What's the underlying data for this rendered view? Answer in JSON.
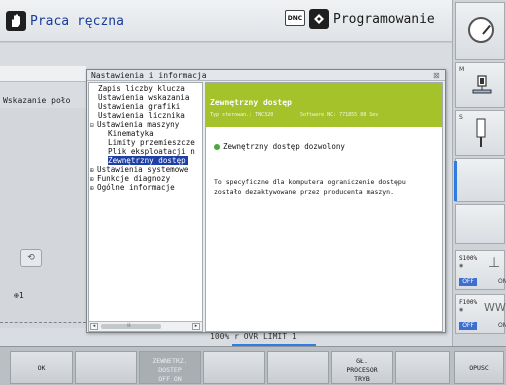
{
  "header": {
    "left_mode": "Praca ręczna",
    "dnc_label": "DNC",
    "right_mode": "Programowanie"
  },
  "background": {
    "left_label": "Wskazanie poło",
    "axis_label": "1",
    "bottom_text": "100% r OVR     LIMIT 1"
  },
  "dialog": {
    "title": "Nastawienia i informacja",
    "close": "⊠",
    "tree": [
      {
        "label": "Zapis liczby klucza",
        "expander": "",
        "level": 1
      },
      {
        "label": "Ustawienia wskazania",
        "expander": "",
        "level": 1
      },
      {
        "label": "Ustawienia grafiki",
        "expander": "",
        "level": 1
      },
      {
        "label": "Ustawienia licznika",
        "expander": "",
        "level": 1
      },
      {
        "label": "Ustawienia maszyny",
        "expander": "⊟",
        "level": 0
      },
      {
        "label": "Kinematyka",
        "expander": "",
        "level": 2
      },
      {
        "label": "Limity przemieszcze",
        "expander": "",
        "level": 2
      },
      {
        "label": "Plik eksploatacji n",
        "expander": "",
        "level": 2
      },
      {
        "label": "Zewnętrzny dostęp",
        "expander": "",
        "level": 2,
        "selected": true
      },
      {
        "label": "Ustawienia systemowe",
        "expander": "⊞",
        "level": 0
      },
      {
        "label": "Funkcje diagnozy",
        "expander": "⊞",
        "level": 0
      },
      {
        "label": "Ogólne informacje",
        "expander": "⊞",
        "level": 0
      }
    ],
    "scroll_left": "◂",
    "scroll_right": "▸",
    "scroll_mid": "⁞⁞",
    "detail": {
      "title": "Zewnętrzny dostęp",
      "type": "Typ sterowan.: TNC320",
      "software": "Software NC: 771855 08 Sev",
      "status": "Zewnętrzny dostęp dozwolony",
      "desc_line1": "To specyficzne dla komputera ograniczenie dostępu",
      "desc_line2": "zostało dezaktywowane przez producenta maszyn."
    }
  },
  "rightcol": {
    "m_label": "M",
    "s_label": "S",
    "s100": {
      "label": "S100%",
      "off": "OFF",
      "on": "ON"
    },
    "f100": {
      "label": "F100%",
      "off": "OFF",
      "on": "ON",
      "glyph": "WW"
    }
  },
  "softkeys": [
    {
      "line1": "OK",
      "line2": "",
      "line3": "",
      "disabled": false
    },
    {
      "line1": "",
      "line2": "",
      "line3": "",
      "disabled": false
    },
    {
      "line1": "ZEWNETRZ.",
      "line2": "DOSTEP",
      "line3": "OFF    ON",
      "disabled": true
    },
    {
      "line1": "",
      "line2": "",
      "line3": "",
      "disabled": false
    },
    {
      "line1": "",
      "line2": "",
      "line3": "",
      "disabled": false
    },
    {
      "line1": "GŁ.",
      "line2": "PROCESOR",
      "line3": "TRYB",
      "disabled": false
    },
    {
      "line1": "",
      "line2": "",
      "line3": "",
      "disabled": false
    },
    {
      "line1": "OPUSC",
      "line2": "",
      "line3": "",
      "disabled": false
    }
  ],
  "colors": {
    "detail_header": "#a5c22a",
    "selection": "#1d3fa6",
    "status_ok": "#4aa73a",
    "accent_blue": "#2f7de0"
  }
}
